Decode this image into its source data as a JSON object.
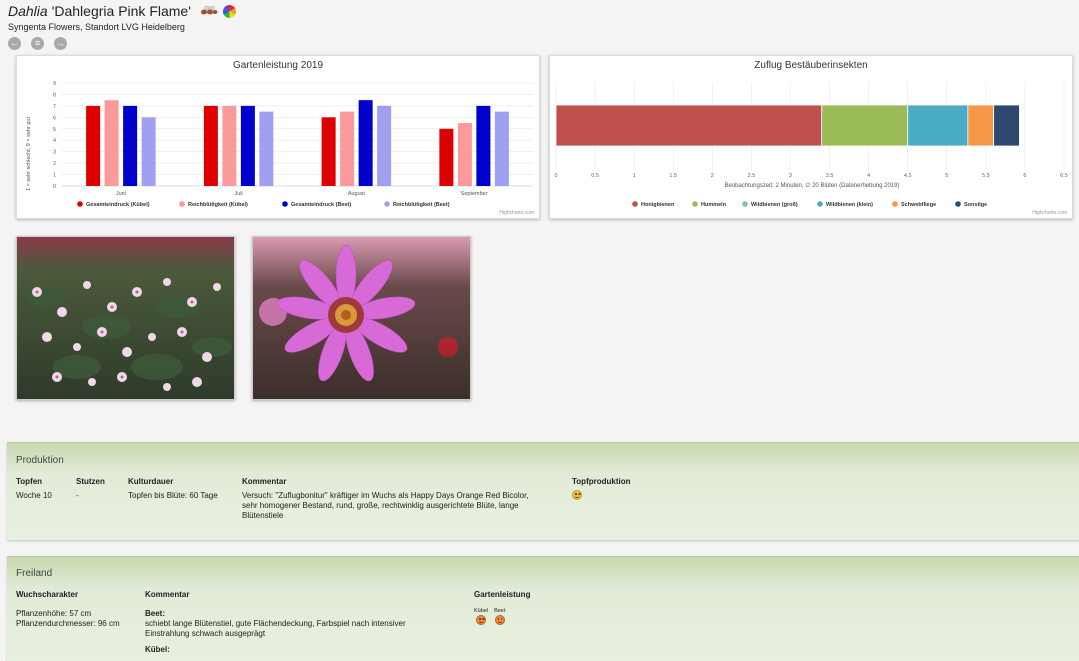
{
  "header": {
    "genus": "Dahlia",
    "cultivar": "'Dahlegria Pink Flame'",
    "subtitle": "Syngenta Flowers, Standort LVG Heidelberg"
  },
  "colors": {
    "gesamt_kuebel": "#dd0000",
    "reich_kuebel": "#fb9a9a",
    "gesamt_beet": "#0000cc",
    "reich_beet": "#a0a0f0",
    "honigbienen": "#c0504d",
    "hummeln": "#9bbb59",
    "wildbienen_gross": "#7cc3a6",
    "wildbienen_klein": "#4bacc6",
    "schwebfliege": "#f79646",
    "sonstige": "#2c4770"
  },
  "chart_garden": {
    "chart_data": {
      "type": "bar",
      "title": "Gartenleistung 2019",
      "ylabel": "1 = sehr schlecht, 9 = sehr gut",
      "ylim": [
        0,
        9
      ],
      "yticks": [
        "0",
        "1",
        "2",
        "3",
        "4",
        "5",
        "6",
        "7",
        "8",
        "9"
      ],
      "categories": [
        "Juni",
        "Juli",
        "August",
        "September"
      ],
      "series": [
        {
          "name": "Gesamteindruck (Kübel)",
          "values": [
            7,
            7,
            6,
            5
          ]
        },
        {
          "name": "Reichblütigkeit (Kübel)",
          "values": [
            7.5,
            7,
            6.5,
            5.5
          ]
        },
        {
          "name": "Gesamteindruck (Beet)",
          "values": [
            7,
            7,
            7.5,
            7
          ]
        },
        {
          "name": "Reichblütigkeit (Beet)",
          "values": [
            6,
            6.5,
            7,
            6.5
          ]
        }
      ]
    },
    "credit": "Highcharts.com"
  },
  "chart_insects": {
    "chart_data": {
      "type": "bar",
      "orientation": "horizontal-stacked",
      "title": "Zuflug Bestäuberinsekten",
      "xlabel": "Beobachtungszeit: 2 Minuten, ∅ 20 Blüten (Datenerhebung 2019)",
      "xlim": [
        0,
        6.5
      ],
      "xticks": [
        "0",
        "0.5",
        "1",
        "1.5",
        "2",
        "2.5",
        "3",
        "3.5",
        "4",
        "4.5",
        "5",
        "5.5",
        "6",
        "6.5"
      ],
      "series": [
        {
          "name": "Honigbienen",
          "value": 3.4
        },
        {
          "name": "Hummeln",
          "value": 1.1
        },
        {
          "name": "Wildbienen (groß)",
          "value": 0
        },
        {
          "name": "Wildbienen (klein)",
          "value": 0.77
        },
        {
          "name": "Schwebfliege",
          "value": 0.33
        },
        {
          "name": "Sonstige",
          "value": 0.33
        }
      ]
    },
    "credit": "Highcharts.com"
  },
  "produktion": {
    "title": "Produktion",
    "headers": {
      "topfen": "Topfen",
      "stutzen": "Stutzen",
      "kulturdauer": "Kulturdauer",
      "kommentar": "Kommentar",
      "topfproduktion": "Topfproduktion"
    },
    "values": {
      "topfen": "Woche 10",
      "stutzen": "-",
      "kulturdauer": "Topfen bis Blüte: 60 Tage",
      "kommentar": "Versuch: \"Zuflugbonitur\" kräftiger im Wuchs als Happy Days Orange Red Bicolor, sehr homogener Bestand, rund, große, rechtwinklig ausgerichtete Blüte, lange Blütenstiele",
      "topfproduktion_icon": "smiley-neutral-icon"
    }
  },
  "freiland": {
    "title": "Freiland",
    "headers": {
      "wuchs": "Wuchscharakter",
      "kommentar": "Kommentar",
      "garten": "Gartenleistung"
    },
    "wuchs": {
      "hoehe": "Pflanzenhöhe: 57 cm",
      "durchmesser": "Pflanzendurchmesser: 96 cm"
    },
    "kommentar": {
      "beet_label": "Beet:",
      "beet_text": "schiebt lange Blütenstiel, gute Flächendeckung, Farbspiel nach intensiver Einstrahlung schwach ausgeprägt",
      "kuebel_label": "Kübel:"
    },
    "garten": {
      "kuebel_label": "Kübel",
      "beet_label": "Beet"
    }
  }
}
